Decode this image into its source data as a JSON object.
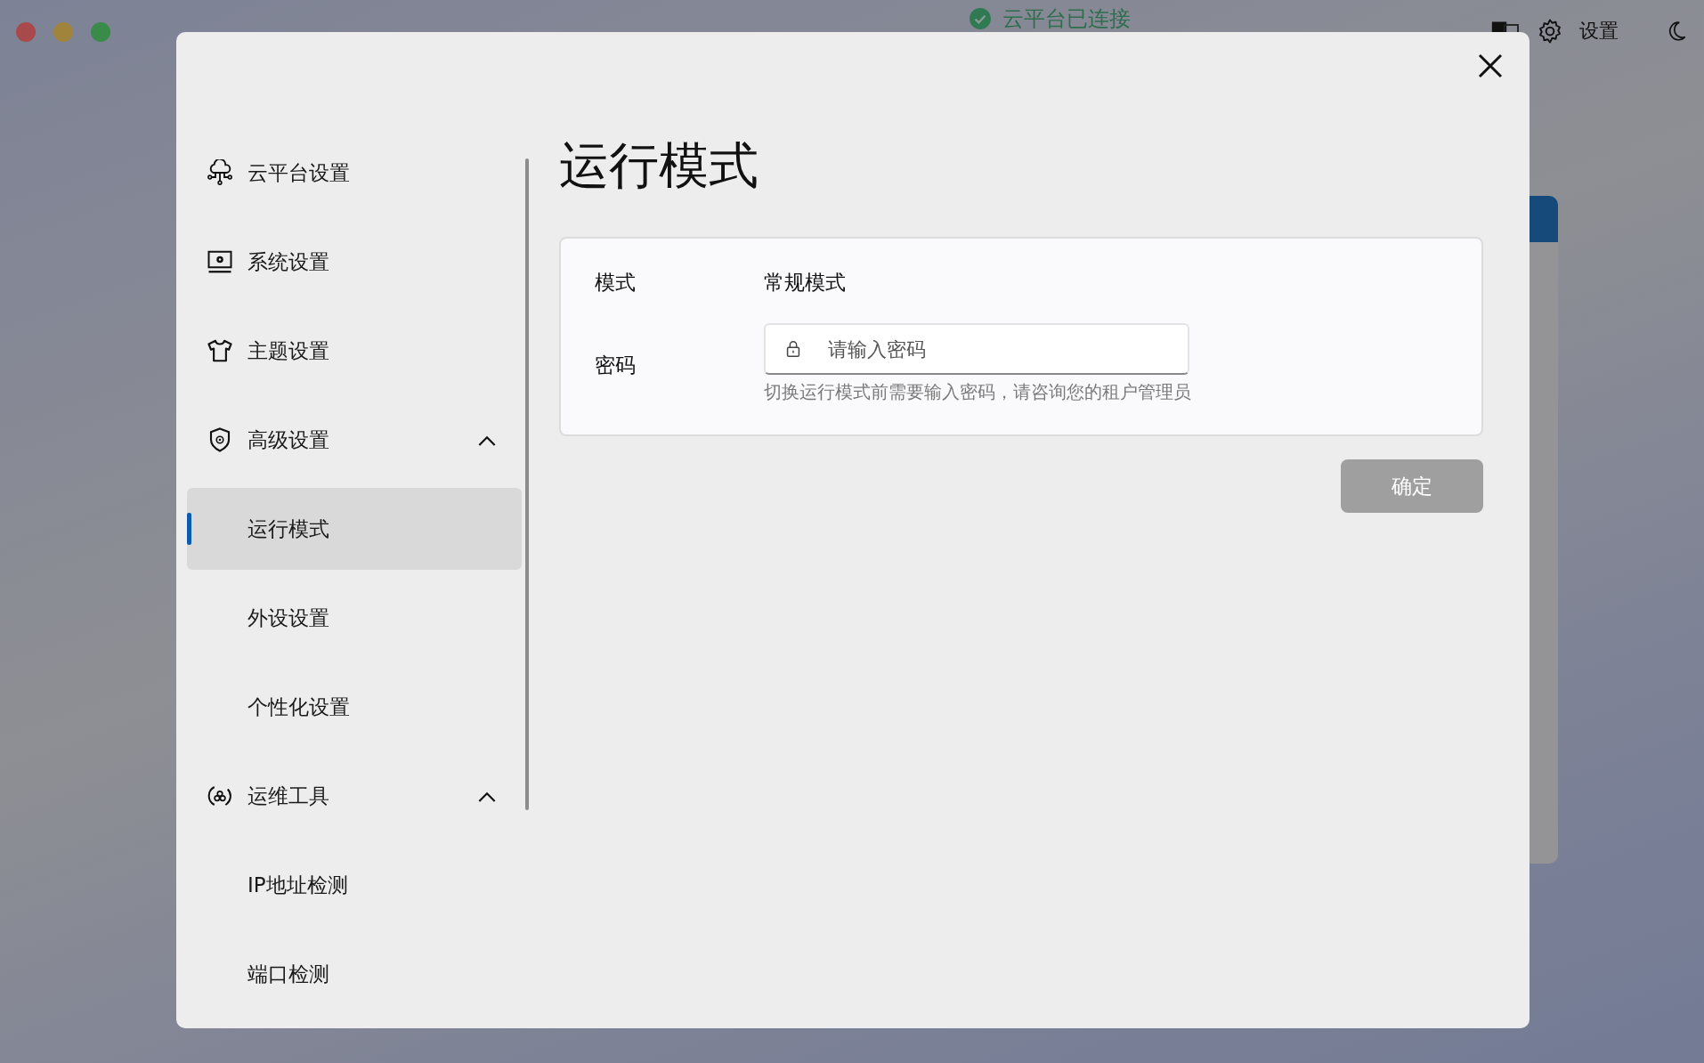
{
  "top_bar": {
    "window_controls": [
      {
        "color": "#a84a4c"
      },
      {
        "color": "#a0843c"
      },
      {
        "color": "#3a8a4a"
      }
    ],
    "status": {
      "label": "云平台已连接",
      "connected": true
    },
    "settings_label": "设置"
  },
  "dialog": {
    "sidebar": {
      "items": [
        {
          "label": "云平台设置",
          "kind": "cloud",
          "selected": false
        },
        {
          "label": "系统设置",
          "kind": "monitor",
          "selected": false
        },
        {
          "label": "主题设置",
          "kind": "shirt",
          "selected": false
        },
        {
          "label": "高级设置",
          "kind": "shield",
          "selected": false,
          "expanded": true,
          "children": [
            {
              "label": "运行模式",
              "selected": true
            },
            {
              "label": "外设设置",
              "selected": false
            },
            {
              "label": "个性化设置",
              "selected": false
            }
          ]
        },
        {
          "label": "运维工具",
          "kind": "tools",
          "selected": false,
          "expanded": true,
          "children": [
            {
              "label": "IP地址检测",
              "selected": false
            },
            {
              "label": "端口检测",
              "selected": false
            }
          ]
        }
      ]
    },
    "title": "运行模式",
    "form": {
      "mode_label": "模式",
      "mode_value": "常规模式",
      "password_label": "密码",
      "password_placeholder": "请输入密码",
      "password_hint": "切换运行模式前需要输入密码，请咨询您的租户管理员"
    },
    "confirm_button": {
      "label": "确定",
      "disabled": true
    }
  }
}
